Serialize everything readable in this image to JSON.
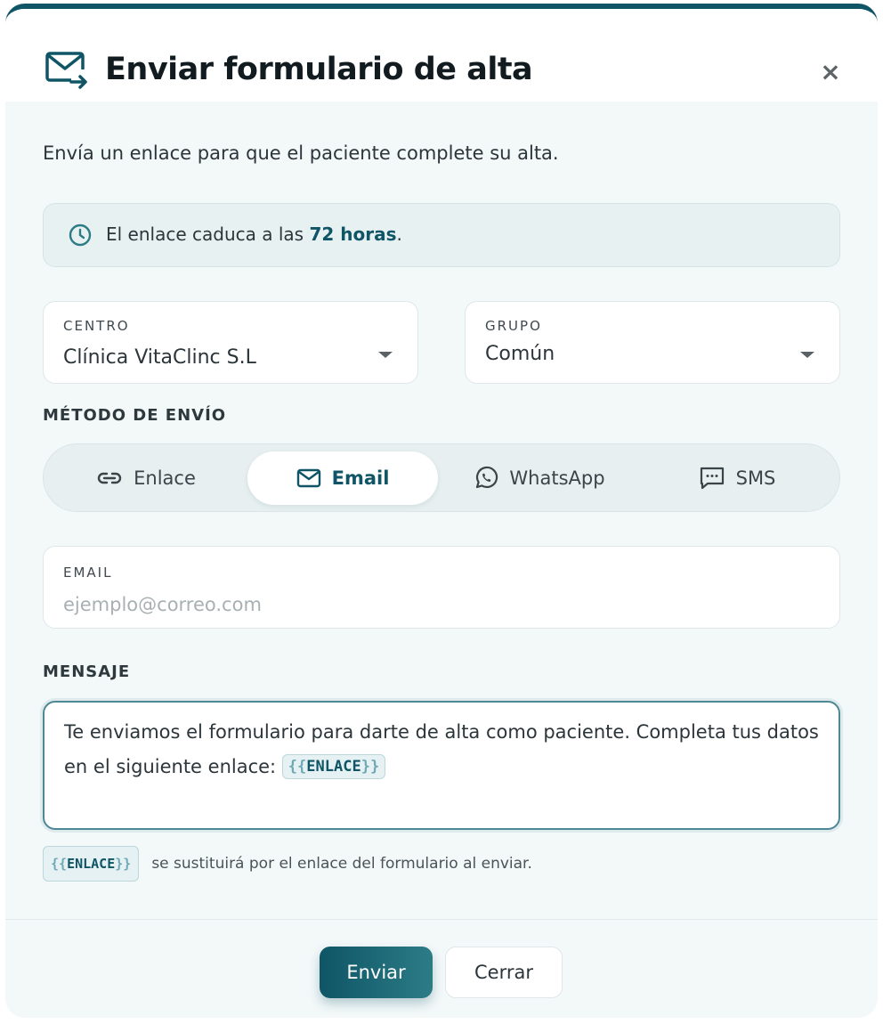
{
  "dialog": {
    "title": "Enviar formulario de alta",
    "close_label": "×",
    "description": "Envía un enlace para que el paciente complete su alta."
  },
  "notice": {
    "prefix": "El enlace caduca a las ",
    "highlight": "72 horas",
    "suffix": "."
  },
  "centro": {
    "label": "CENTRO",
    "value": "Clínica VitaClinc S.L"
  },
  "grupo": {
    "label": "GRUPO",
    "value": "Común"
  },
  "method_section": {
    "label": "MÉTODO DE ENVÍO",
    "options": [
      {
        "label": "Enlace",
        "icon": "link-icon"
      },
      {
        "label": "Email",
        "icon": "mail-icon"
      },
      {
        "label": "WhatsApp",
        "icon": "whatsapp-icon"
      },
      {
        "label": "SMS",
        "icon": "sms-icon"
      }
    ],
    "selected": "Email"
  },
  "email": {
    "label": "EMAIL",
    "placeholder": "ejemplo@correo.com",
    "value": ""
  },
  "message_section": {
    "label": "MENSAJE",
    "text": "Te enviamos el formulario para darte de alta como paciente. Completa tus datos en el siguiente enlace: ",
    "token_open": "{{",
    "token_name": "ENLACE",
    "token_close": "}}"
  },
  "hint": {
    "token_open": "{{",
    "token_name": "ENLACE",
    "token_close": "}}",
    "text": "se sustituirá por el enlace del formulario al enviar."
  },
  "footer": {
    "send_label": "Enviar",
    "close_label": "Cerrar"
  },
  "colors": {
    "accent": "#0f5566",
    "background": "#f3f8f9",
    "border": "#dfe7e9"
  }
}
